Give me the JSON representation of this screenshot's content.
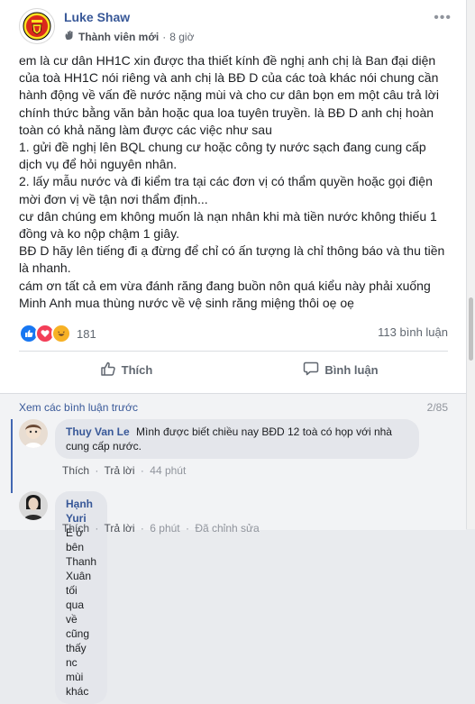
{
  "post": {
    "author": "Luke Shaw",
    "role": "Thành viên mới",
    "time": "8 giờ",
    "lines": [
      "em là cư dân HH1C xin được tha thiết kính đề nghị anh chị là Ban đại diện của toà HH1C nói riêng và anh chị là BĐ D của các toà khác nói chung cần hành động về vấn đề nước nặng mùi và cho cư dân bọn em một câu trả lời chính thức bằng văn bản hoặc qua loa tuyên truyền. là BĐ D anh chị hoàn toàn có khả năng làm được các việc như sau",
      "1. gửi đề nghị lên BQL chung cư hoặc công ty nước sạch đang cung cấp dịch vụ để hỏi nguyên nhân.",
      "2. lấy mẫu nước và đi kiểm tra tại các đơn vị có thẩm quyền hoặc gọi điện mời đơn vị về tận nơi thẩm định...",
      "cư dân chúng em không muốn là nạn nhân khi mà tiền nước không thiếu 1 đồng và ko nộp chậm 1 giây.",
      "BĐ D hãy lên tiếng đi ạ đừng để chỉ có ấn tượng là chỉ thông báo và thu tiền là nhanh.",
      "cám ơn tất cả em vừa đánh răng đang buồn nôn quá kiểu này phải xuống Minh Anh mua thùng nước về vệ sinh răng miệng thôi oẹ oẹ"
    ],
    "reaction_count": "181",
    "comment_count": "113 bình luận",
    "like_label": "Thích",
    "comment_label": "Bình luận"
  },
  "comments_section": {
    "prev_link": "Xem các bình luận trước",
    "pager": "2/85",
    "items": [
      {
        "name": "Thuy Van Le",
        "text": "Mình được biết chiều nay BĐD 12 toà có họp với nhà cung cấp nước.",
        "like": "Thích",
        "reply": "Trả lời",
        "time": "44 phút",
        "edited": ""
      },
      {
        "name": "Hạnh Yuri",
        "text": "E ở bên Thanh Xuân tối qua về cũng thấy nc mùi khác",
        "like": "Thích",
        "reply": "Trả lời",
        "time": "6 phút",
        "edited": "Đã chỉnh sửa"
      }
    ]
  },
  "icons": {
    "avatar": "manchester-united-crest",
    "role_badge": "waving-hand-icon",
    "more": "more-options-icon",
    "reactions": [
      "like-reaction-icon",
      "love-reaction-icon",
      "haha-reaction-icon"
    ],
    "like": "thumbs-up-icon",
    "comment": "speech-bubble-icon"
  },
  "colors": {
    "link": "#385898",
    "accent": "#4267b2",
    "love": "#f33e58",
    "haha": "#f7b125",
    "like": "#1877f2"
  }
}
